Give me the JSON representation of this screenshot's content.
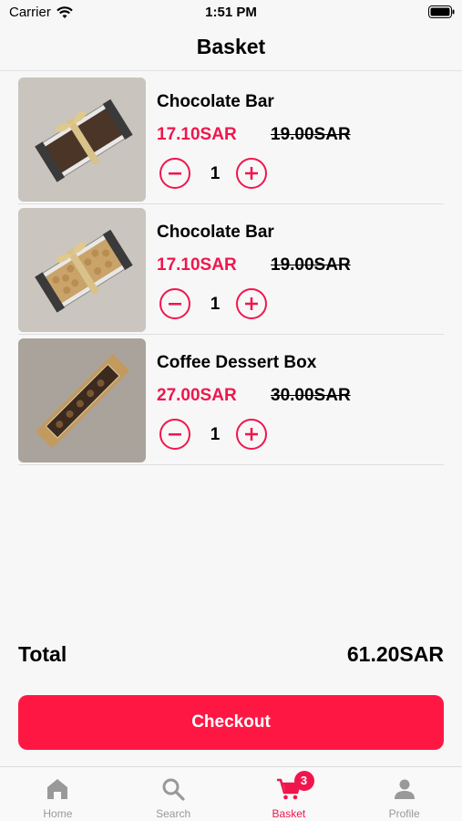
{
  "status_bar": {
    "carrier": "Carrier",
    "time": "1:51 PM"
  },
  "header": {
    "title": "Basket"
  },
  "colors": {
    "accent": "#f0164d",
    "checkout": "#ff1744",
    "inactive_tab": "#999999"
  },
  "items": [
    {
      "name": "Chocolate Bar",
      "price": "17.10SAR",
      "old_price": "19.00SAR",
      "quantity": "1",
      "image": "chocolate-bar-dark-photo"
    },
    {
      "name": "Chocolate Bar",
      "price": "17.10SAR",
      "old_price": "19.00SAR",
      "quantity": "1",
      "image": "chocolate-bar-nuts-photo"
    },
    {
      "name": "Coffee Dessert Box",
      "price": "27.00SAR",
      "old_price": "30.00SAR",
      "quantity": "1",
      "image": "coffee-dessert-box-photo"
    }
  ],
  "total": {
    "label": "Total",
    "amount": "61.20SAR"
  },
  "checkout": {
    "label": "Checkout"
  },
  "tabs": [
    {
      "label": "Home",
      "icon": "home-icon",
      "active": false
    },
    {
      "label": "Search",
      "icon": "search-icon",
      "active": false
    },
    {
      "label": "Basket",
      "icon": "cart-icon",
      "active": true,
      "badge": "3"
    },
    {
      "label": "Profile",
      "icon": "person-icon",
      "active": false
    }
  ]
}
